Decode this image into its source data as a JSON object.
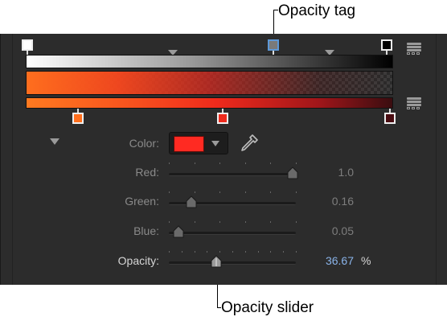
{
  "callouts": {
    "top": "Opacity tag",
    "bottom": "Opacity slider"
  },
  "controls": {
    "color": {
      "label": "Color:",
      "swatch": "#ff2a22"
    },
    "rows": [
      {
        "key": "red",
        "label": "Red:",
        "value": "1.0",
        "level": 1.0,
        "active": false,
        "ticks": 5
      },
      {
        "key": "green",
        "label": "Green:",
        "value": "0.16",
        "level": 0.16,
        "active": false,
        "ticks": 5
      },
      {
        "key": "blue",
        "label": "Blue:",
        "value": "0.05",
        "level": 0.05,
        "active": false,
        "ticks": 5
      },
      {
        "key": "opacity",
        "label": "Opacity:",
        "value": "36.67",
        "level": 0.3667,
        "active": true,
        "ticks": 10
      }
    ],
    "unit": "%"
  },
  "icons": [
    "disclosure-triangle-icon",
    "eyedropper-icon",
    "popup-arrow-icon"
  ],
  "colors": {
    "accent": "#5c98d8",
    "panel": "#2c2c2c",
    "selected_value": "#8ab4ea"
  }
}
